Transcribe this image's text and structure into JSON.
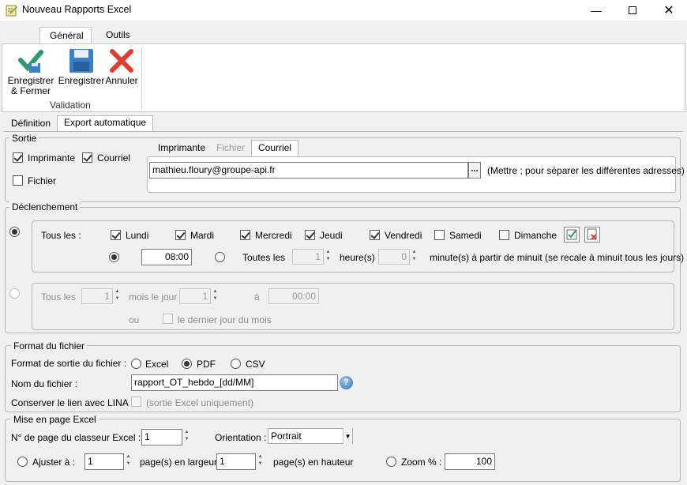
{
  "window": {
    "title": "Nouveau Rapports Excel",
    "icon": "report-pencil-icon",
    "controls": [
      "minimize-icon",
      "maximize-icon",
      "close-icon"
    ]
  },
  "ribbon": {
    "tabs": [
      {
        "label": "Général",
        "active": true
      },
      {
        "label": "Outils",
        "active": false
      }
    ],
    "buttons": {
      "save_close": "Enregistrer\n& Fermer",
      "save": "Enregistrer",
      "cancel": "Annuler"
    },
    "group_label": "Validation"
  },
  "page_tabs": [
    {
      "label": "Définition",
      "active": false
    },
    {
      "label": "Export automatique",
      "active": true
    }
  ],
  "sortie": {
    "legend": "Sortie",
    "imprimante_label": "Imprimante",
    "imprimante_checked": true,
    "courriel_label": "Courriel",
    "courriel_checked": true,
    "fichier_label": "Fichier",
    "fichier_checked": false,
    "subtabs": [
      {
        "label": "Imprimante",
        "state": "normal"
      },
      {
        "label": "Fichier",
        "state": "disabled"
      },
      {
        "label": "Courriel",
        "state": "active"
      }
    ],
    "email_value": "mathieu.floury@groupe-api.fr",
    "browse_label": "...",
    "hint": "(Mettre ; pour séparer les différentes adresses)"
  },
  "declenchement": {
    "legend": "Déclenchement",
    "weekly": {
      "selected": true,
      "prefix": "Tous les :",
      "days": [
        {
          "label": "Lundi",
          "checked": true
        },
        {
          "label": "Mardi",
          "checked": true
        },
        {
          "label": "Mercredi",
          "checked": true
        },
        {
          "label": "Jeudi",
          "checked": true
        },
        {
          "label": "Vendredi",
          "checked": true
        },
        {
          "label": "Samedi",
          "checked": false
        },
        {
          "label": "Dimanche",
          "checked": false
        }
      ],
      "check_all_icon": "check-all-icon",
      "uncheck_all_icon": "uncheck-all-icon",
      "time_selected": true,
      "time_value": "08:00",
      "every_label": "Toutes les",
      "hours_value": "1",
      "hours_label": "heure(s)",
      "minutes_value": "0",
      "minutes_label": "minute(s) à partir de minuit (se recale à minuit tous les jours)"
    },
    "monthly": {
      "selected": false,
      "prefix": "Tous les",
      "months_value": "1",
      "months_label": "mois le jour",
      "day_value": "1",
      "at_label": "à",
      "time_value": "00:00",
      "or_label": "ou",
      "last_day_label": "le dernier jour du mois"
    }
  },
  "format": {
    "legend": "Format du fichier",
    "output_label": "Format de sortie du fichier :",
    "options": [
      {
        "label": "Excel",
        "selected": false
      },
      {
        "label": "PDF",
        "selected": true
      },
      {
        "label": "CSV",
        "selected": false
      }
    ],
    "filename_label": "Nom du fichier :",
    "filename_value": "rapport_OT_hebdo_[dd/MM]",
    "help_icon": "help-icon",
    "lina_label": "Conserver le lien avec LINA :",
    "lina_hint": "(sortie Excel uniquement)"
  },
  "mise_en_page": {
    "legend": "Mise en page Excel",
    "page_label": "N° de page du classeur Excel :",
    "page_value": "1",
    "orientation_label": "Orientation :",
    "orientation_value": "Portrait",
    "fit_label": "Ajuster à :",
    "fit_width_value": "1",
    "fit_width_label": "page(s) en largeur",
    "fit_height_value": "1",
    "fit_height_label": "page(s) en hauteur",
    "zoom_label": "Zoom % :",
    "zoom_value": "100"
  },
  "colors": {
    "check_green": "#2e9c6a",
    "save_blue": "#3b7fc4",
    "cancel_red": "#e03c31"
  }
}
